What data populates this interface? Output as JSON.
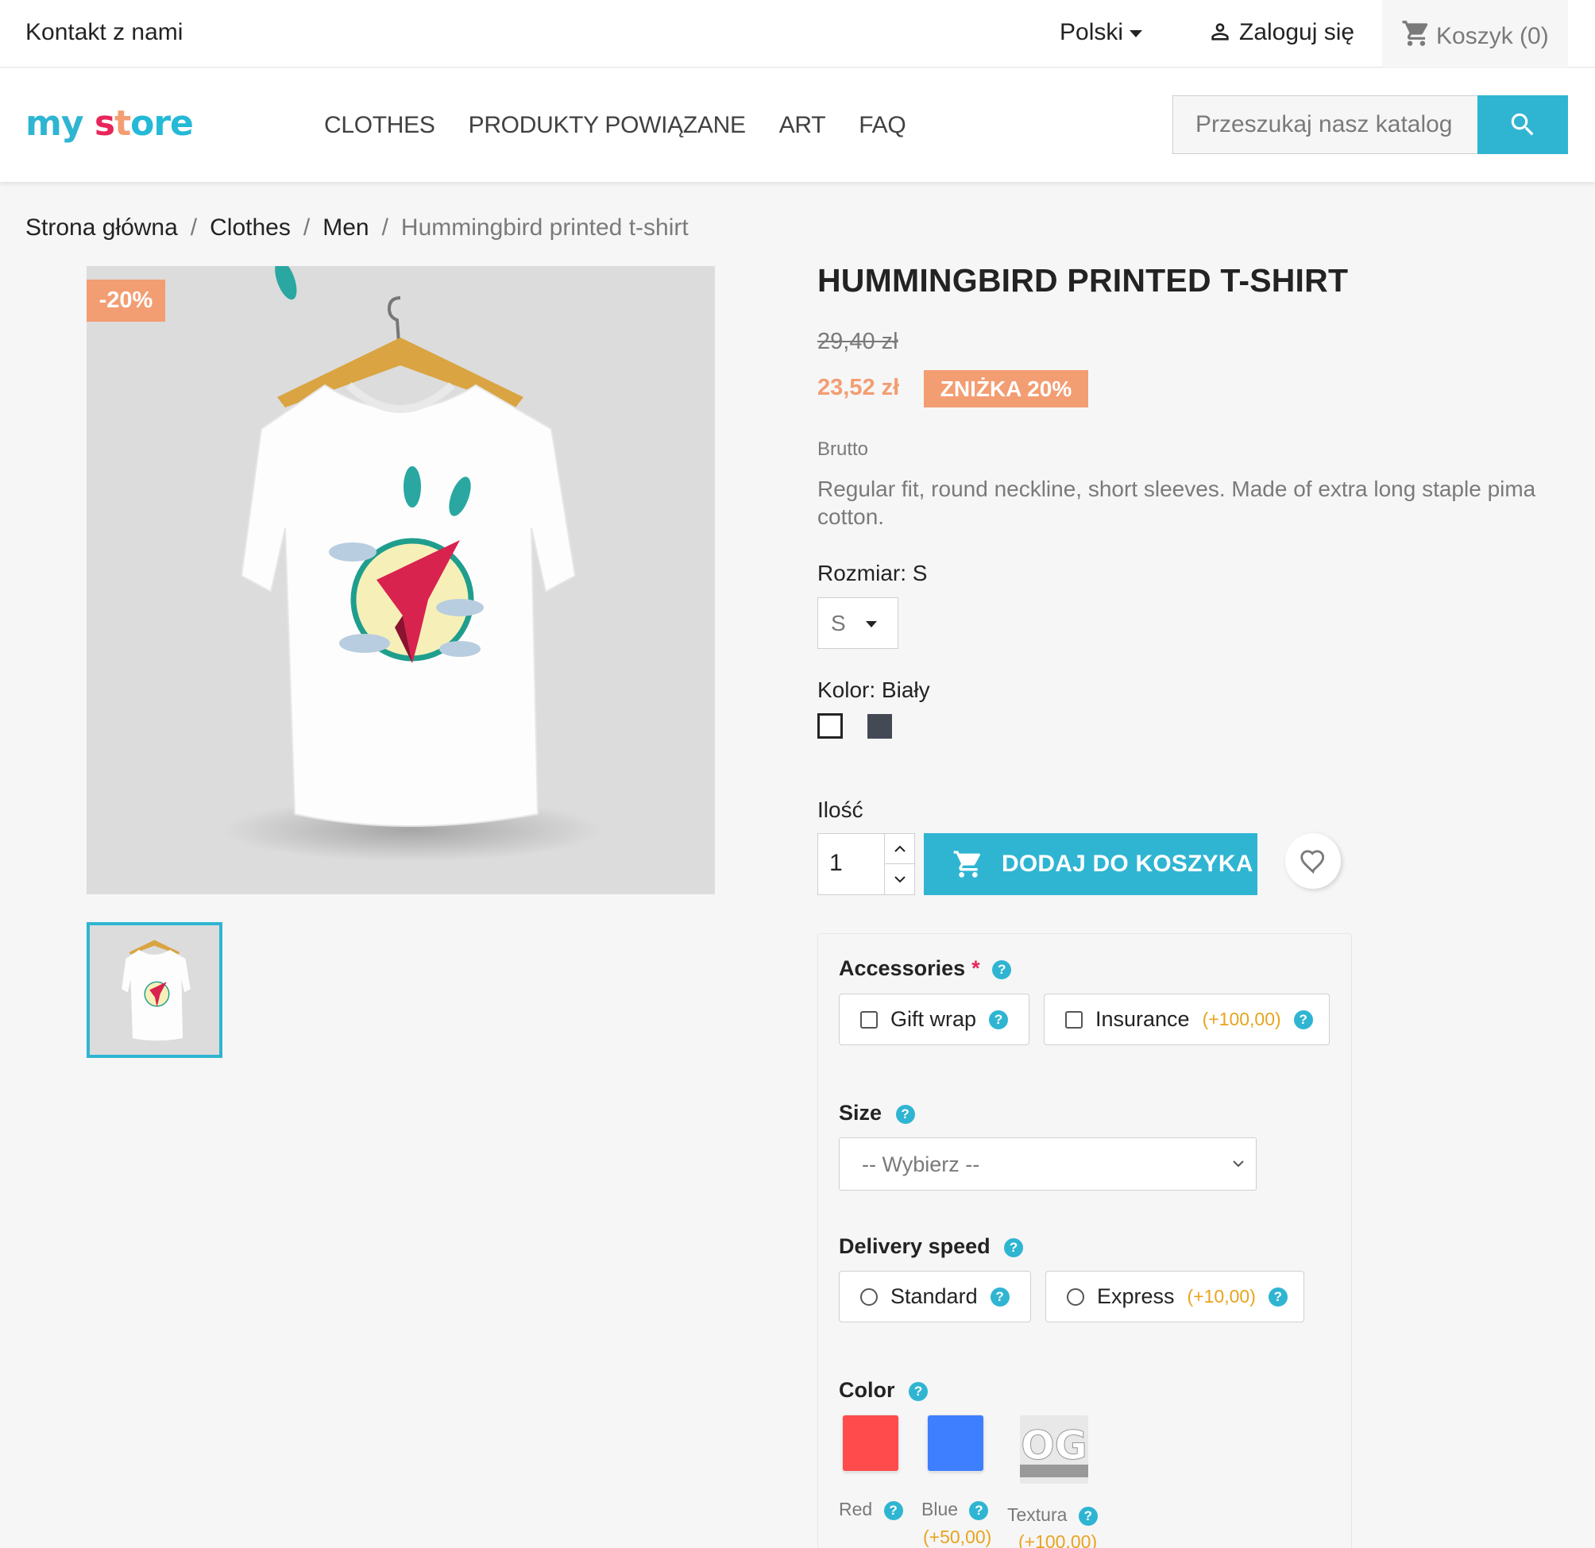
{
  "topbar": {
    "contact": "Kontakt z nami",
    "language": "Polski",
    "login": "Zaloguj się",
    "cart": "Koszyk (0)"
  },
  "header": {
    "logo_parts": [
      "my",
      "s",
      "t",
      "ore"
    ],
    "nav": [
      "CLOTHES",
      "PRODUKTY POWIĄZANE",
      "ART",
      "FAQ"
    ],
    "search_placeholder": "Przeszukaj nasz katalog"
  },
  "breadcrumb": [
    "Strona główna",
    "Clothes",
    "Men",
    "Hummingbird printed t-shirt"
  ],
  "product": {
    "flag": "-20%",
    "title": "HUMMINGBIRD PRINTED T-SHIRT",
    "old_price": "29,40 zł",
    "price": "23,52 zł",
    "discount": "ZNIŻKA 20%",
    "tax_label": "Brutto",
    "description": "Regular fit, round neckline, short sleeves. Made of extra long staple pima cotton.",
    "size_label": "Rozmiar: S",
    "size_value": "S",
    "color_label": "Kolor: Biały",
    "colors": [
      "#ffffff",
      "#434a54"
    ],
    "qty_label": "Ilość",
    "qty_value": "1",
    "add_to_cart": "DODAJ DO KOSZYKA"
  },
  "custom": {
    "accessories_label": "Accessories",
    "required_mark": "*",
    "help": "?",
    "gift_wrap": "Gift wrap",
    "insurance": "Insurance",
    "insurance_price": "(+100,00)",
    "size_label": "Size",
    "size_placeholder": "-- Wybierz --",
    "delivery_label": "Delivery speed",
    "standard": "Standard",
    "express": "Express",
    "express_price": "(+10,00)",
    "color_label": "Color",
    "color_red": "Red",
    "color_blue": "Blue",
    "blue_price": "(+50,00)",
    "texture": "Textura",
    "texture_price": "(+100,00)",
    "swatch_colors": {
      "red": "#ff4b4b",
      "blue": "#3e7fff"
    }
  },
  "colors": {
    "accent": "#2fb5d2",
    "discount": "#f39d72",
    "price_extra": "#e8a41f"
  }
}
